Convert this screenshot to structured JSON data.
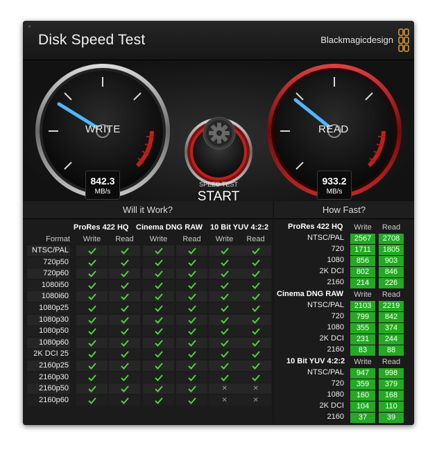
{
  "window": {
    "title": "Disk Speed Test",
    "brand": "Blackmagicdesign",
    "close_glyph": "×"
  },
  "gauges": {
    "write": {
      "label": "WRITE",
      "value": "842.3",
      "unit": "MB/s"
    },
    "read": {
      "label": "READ",
      "value": "933.2",
      "unit": "MB/s"
    }
  },
  "start": {
    "line1": "SPEED TEST",
    "line2": "START"
  },
  "icons": {
    "settings": "gear-icon",
    "close": "close-icon",
    "check": "check-icon",
    "cross": "cross-icon",
    "logo": "blackmagic-logo-icon"
  },
  "colors": {
    "needle": "#4fb6ff",
    "check": "#4fd43a",
    "value_green": "#22aa22",
    "red_accent": "#c0201a",
    "bezel_red": "#9b1a1a"
  },
  "will_it_work": {
    "heading": "Will it Work?",
    "format_label": "Format",
    "groups": [
      "ProRes 422 HQ",
      "Cinema DNG RAW",
      "10 Bit YUV 4:2:2"
    ],
    "subcols": [
      "Write",
      "Read"
    ],
    "rows": [
      {
        "format": "NTSC/PAL",
        "status": [
          1,
          1,
          1,
          1,
          1,
          1
        ]
      },
      {
        "format": "720p50",
        "status": [
          1,
          1,
          1,
          1,
          1,
          1
        ]
      },
      {
        "format": "720p60",
        "status": [
          1,
          1,
          1,
          1,
          1,
          1
        ]
      },
      {
        "format": "1080i50",
        "status": [
          1,
          1,
          1,
          1,
          1,
          1
        ]
      },
      {
        "format": "1080i60",
        "status": [
          1,
          1,
          1,
          1,
          1,
          1
        ]
      },
      {
        "format": "1080p25",
        "status": [
          1,
          1,
          1,
          1,
          1,
          1
        ]
      },
      {
        "format": "1080p30",
        "status": [
          1,
          1,
          1,
          1,
          1,
          1
        ]
      },
      {
        "format": "1080p50",
        "status": [
          1,
          1,
          1,
          1,
          1,
          1
        ]
      },
      {
        "format": "1080p60",
        "status": [
          1,
          1,
          1,
          1,
          1,
          1
        ]
      },
      {
        "format": "2K DCI 25",
        "status": [
          1,
          1,
          1,
          1,
          1,
          1
        ]
      },
      {
        "format": "2160p25",
        "status": [
          1,
          1,
          1,
          1,
          1,
          1
        ]
      },
      {
        "format": "2160p30",
        "status": [
          1,
          1,
          1,
          1,
          1,
          1
        ]
      },
      {
        "format": "2160p50",
        "status": [
          1,
          1,
          1,
          1,
          0,
          0
        ]
      },
      {
        "format": "2160p60",
        "status": [
          1,
          1,
          1,
          1,
          0,
          0
        ]
      }
    ]
  },
  "how_fast": {
    "heading": "How Fast?",
    "subcols": [
      "Write",
      "Read"
    ],
    "groups": [
      {
        "name": "ProRes 422 HQ",
        "rows": [
          {
            "format": "NTSC/PAL",
            "write": "2567",
            "read": "2708"
          },
          {
            "format": "720",
            "write": "1711",
            "read": "1805"
          },
          {
            "format": "1080",
            "write": "856",
            "read": "903"
          },
          {
            "format": "2K DCI",
            "write": "802",
            "read": "846"
          },
          {
            "format": "2160",
            "write": "214",
            "read": "226"
          }
        ]
      },
      {
        "name": "Cinema DNG RAW",
        "rows": [
          {
            "format": "NTSC/PAL",
            "write": "2103",
            "read": "2219"
          },
          {
            "format": "720",
            "write": "799",
            "read": "842"
          },
          {
            "format": "1080",
            "write": "355",
            "read": "374"
          },
          {
            "format": "2K DCI",
            "write": "231",
            "read": "244"
          },
          {
            "format": "2160",
            "write": "83",
            "read": "88"
          }
        ]
      },
      {
        "name": "10 Bit YUV 4:2:2",
        "rows": [
          {
            "format": "NTSC/PAL",
            "write": "947",
            "read": "998"
          },
          {
            "format": "720",
            "write": "359",
            "read": "379"
          },
          {
            "format": "1080",
            "write": "160",
            "read": "168"
          },
          {
            "format": "2K DCI",
            "write": "104",
            "read": "110"
          },
          {
            "format": "2160",
            "write": "37",
            "read": "39"
          }
        ]
      }
    ]
  }
}
